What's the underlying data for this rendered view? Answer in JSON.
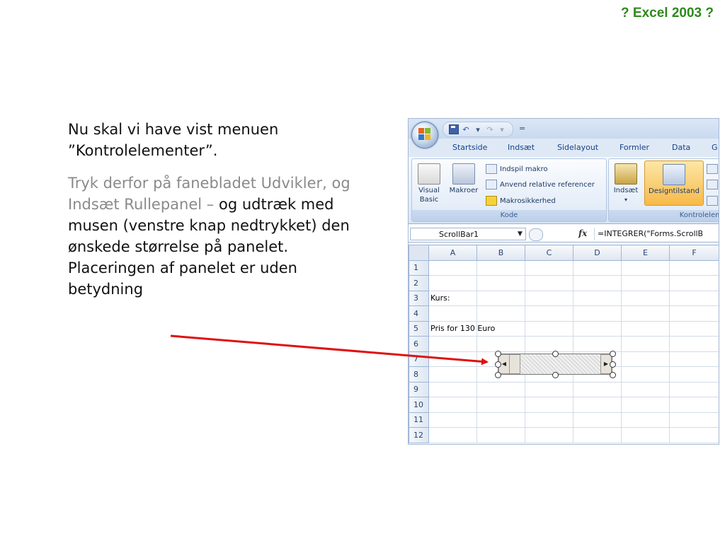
{
  "header": "? Excel 2003 ?",
  "text": {
    "p1": "Nu skal vi have vist menuen ”Kontrolelementer”.",
    "p2_gray": "Tryk derfor på fanebladet Udvikler, og Indsæt Rullepanel –",
    "p2_rest": "og udtræk med musen (venstre knap nedtrykket) den ønskede størrelse på panelet. Placeringen af panelet er uden betydning"
  },
  "excel": {
    "qat_customize": "=",
    "tabs": [
      "Startside",
      "Indsæt",
      "Sidelayout",
      "Formler",
      "Data",
      "G"
    ],
    "code_group": {
      "label": "Kode",
      "visual_basic": "Visual Basic",
      "macros": "Makroer",
      "record_macro": "Indspil makro",
      "relative_refs": "Anvend relative referencer",
      "macro_security": "Makrosikkerhed"
    },
    "controls_group": {
      "label": "Kontroleleme",
      "insert": "Indsæt",
      "design_mode": "Designtilstand"
    },
    "name_box": "ScrollBar1",
    "fx": "fx",
    "formula": "=INTEGRER(\"Forms.ScrollB",
    "columns": [
      "A",
      "B",
      "C",
      "D",
      "E",
      "F"
    ],
    "rows": [
      "1",
      "2",
      "3",
      "4",
      "5",
      "6",
      "7",
      "8",
      "9",
      "10",
      "11",
      "12"
    ],
    "cells": {
      "a3": "Kurs:",
      "a5": "Pris for 130 Euro"
    },
    "arrow_color": "#e01010"
  }
}
